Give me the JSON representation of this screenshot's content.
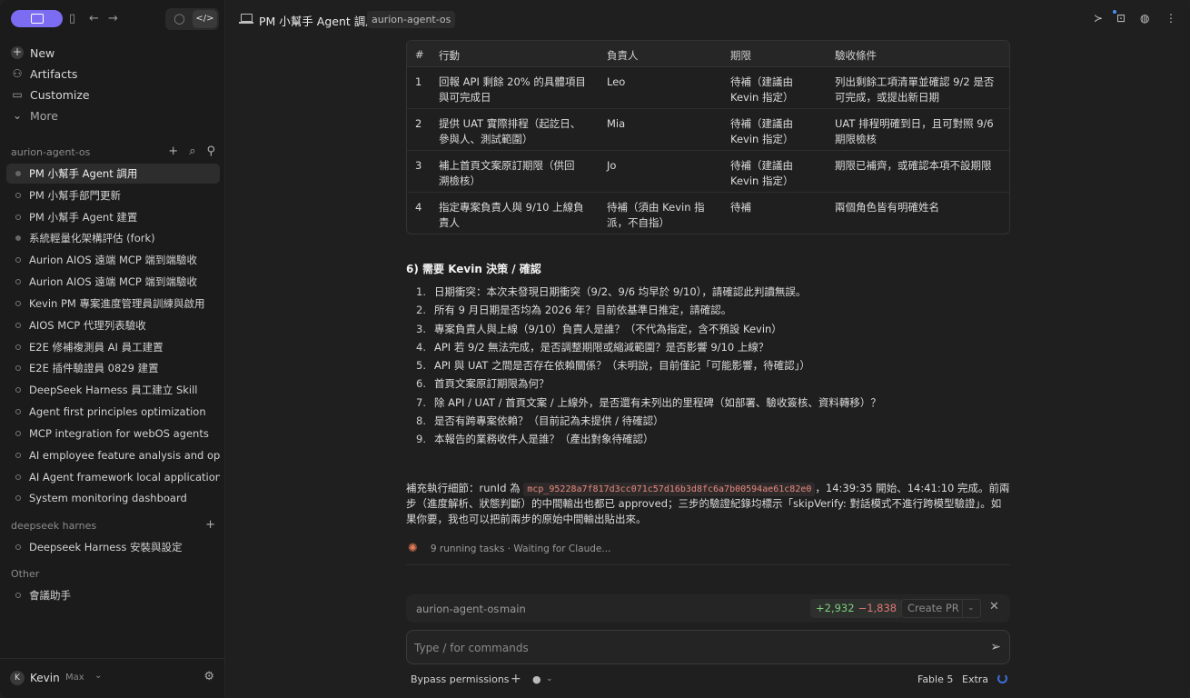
{
  "sidebar": {
    "nav": [
      {
        "label": "New",
        "icon": "plus-icon"
      },
      {
        "label": "Artifacts",
        "icon": "artifacts-icon"
      },
      {
        "label": "Customize",
        "icon": "customize-icon"
      },
      {
        "label": "More",
        "icon": "chevron-down-icon"
      }
    ],
    "groups": [
      {
        "label": "aurion-agent-os",
        "threads": [
          "PM 小幫手 Agent 調用",
          "PM 小幫手部門更新",
          "PM 小幫手 Agent 建置",
          "系統輕量化架構評估 (fork)",
          "Aurion AIOS 遠端 MCP 端到端驗收",
          "Aurion AIOS 遠端 MCP 端到端驗收",
          "Kevin PM 專案進度管理員訓練與啟用",
          "AIOS MCP 代理列表驗收",
          "E2E 修補複測員 AI 員工建置",
          "E2E 插件驗證員 0829 建置",
          "DeepSeek Harness 員工建立 Skill",
          "Agent first principles optimization",
          "MCP integration for webOS agents",
          "AI employee feature analysis and optim",
          "AI Agent framework local application",
          "System monitoring dashboard"
        ]
      },
      {
        "label": "deepseek harnes",
        "threads": [
          "Deepseek Harness 安裝與設定"
        ]
      },
      {
        "label": "Other",
        "threads": [
          "會議助手"
        ]
      }
    ],
    "user": {
      "initial": "K",
      "name": "Kevin",
      "plan": "Max"
    }
  },
  "header": {
    "title": "PM 小幫手 Agent 調用",
    "chip": "aurion-agent-os"
  },
  "table": {
    "headers": [
      "#",
      "行動",
      "負責人",
      "期限",
      "驗收條件"
    ],
    "rows": [
      [
        "1",
        "回報 API 剩餘 20% 的具體項目\n與可完成日",
        "Leo",
        "待補（建議由\nKevin 指定）",
        "列出剩餘工項清單並確認 9/2 是否\n可完成，或提出新日期"
      ],
      [
        "2",
        "提供 UAT 實際排程（起訖日、\n參與人、測試範圍）",
        "Mia",
        "待補（建議由\nKevin 指定）",
        "UAT 排程明確到日，且可對照 9/6\n期限檢核"
      ],
      [
        "3",
        "補上首頁文案原訂期限（供回\n溯檢核）",
        "Jo",
        "待補（建議由\nKevin 指定）",
        "期限已補齊，或確認本項不設期限"
      ],
      [
        "4",
        "指定專案負責人與 9/10 上線負\n責人",
        "待補（須由 Kevin 指\n派，不自指）",
        "待補",
        "兩個角色皆有明確姓名"
      ]
    ]
  },
  "section6": {
    "title": "6) 需要 Kevin 決策 / 確認",
    "items": [
      "日期衝突：本次未發現日期衝突（9/2、9/6 均早於 9/10），請確認此判讀無誤。",
      "所有 9 月日期是否均為 2026 年？目前依基準日推定，請確認。",
      "專案負責人與上線（9/10）負責人是誰？（不代為指定，含不預設 Kevin）",
      "API 若 9/2 無法完成，是否調整期限或縮減範圍？是否影響 9/10 上線？",
      "API 與 UAT 之間是否存在依賴關係？（未明說，目前僅記「可能影響，待確認」）",
      "首頁文案原訂期限為何？",
      "除 API / UAT / 首頁文案 / 上線外，是否還有未列出的里程碑（如部署、驗收簽核、資料轉移）？",
      "是否有跨專案依賴？（目前記為未提供 / 待確認）",
      "本報告的業務收件人是誰？（產出對象待確認）"
    ]
  },
  "detail": {
    "prefix": "補充執行細節：runId 為 ",
    "run_id": "mcp_95228a7f817d3cc071c57d16b3d8fc6a7b00594ae61c82e0",
    "suffix": "，14:39:35 開始、14:41:10 完成。前兩步（進度解析、狀態判斷）的中間輸出也都已 approved；三步的驗證紀錄均標示「skipVerify: 對話模式不進行跨模型驗證」。如果你要，我也可以把前兩步的原始中間輸出貼出來。"
  },
  "status": {
    "running": "9 running tasks · Waiting for Claude..."
  },
  "repo_bar": {
    "repo": "aurion-agent-os",
    "branch": "main",
    "added": "+2,932",
    "removed": "−1,838",
    "create_pr": "Create PR"
  },
  "composer": {
    "placeholder": "Type / for commands"
  },
  "bottom": {
    "permissions": "Bypass permissions",
    "model": "Fable 5",
    "effort": "Extra"
  },
  "colors": {
    "accent": "#7b6cf2",
    "code": "#e7897f",
    "added": "#7ccf7c",
    "removed": "#e07777"
  }
}
